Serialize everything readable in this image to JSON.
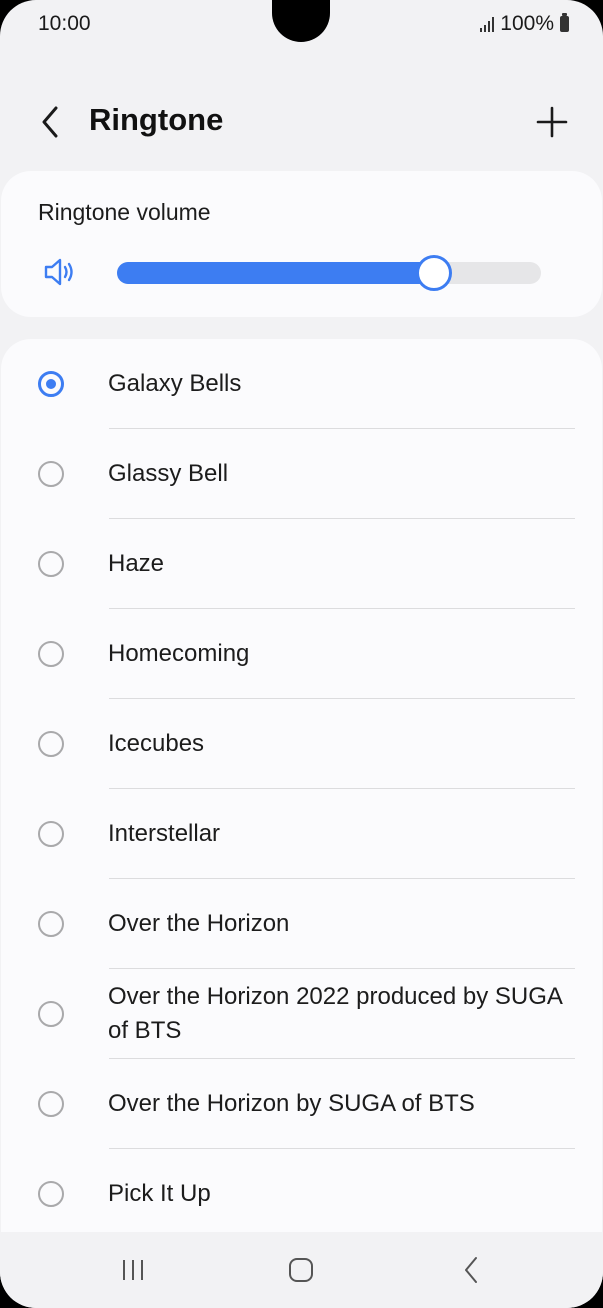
{
  "status_bar": {
    "time": "10:00",
    "battery": "100%"
  },
  "header": {
    "title": "Ringtone"
  },
  "volume": {
    "label": "Ringtone volume",
    "level": 0.74
  },
  "ringtones": [
    {
      "label": "Galaxy Bells",
      "selected": true
    },
    {
      "label": "Glassy Bell",
      "selected": false
    },
    {
      "label": "Haze",
      "selected": false
    },
    {
      "label": "Homecoming",
      "selected": false
    },
    {
      "label": "Icecubes",
      "selected": false
    },
    {
      "label": "Interstellar",
      "selected": false
    },
    {
      "label": "Over the Horizon",
      "selected": false
    },
    {
      "label": "Over the Horizon 2022 produced by SUGA of BTS",
      "selected": false
    },
    {
      "label": "Over the Horizon by SUGA of BTS",
      "selected": false
    },
    {
      "label": "Pick It Up",
      "selected": false
    }
  ],
  "icons": {
    "back": "chevron-left-icon",
    "add": "plus-icon",
    "volume": "speaker-icon",
    "nav_recents": "recent-apps-icon",
    "nav_home": "home-icon",
    "nav_back": "back-icon"
  },
  "colors": {
    "accent": "#3d7df2",
    "background": "#f2f2f4",
    "card": "#fbfbfd"
  }
}
